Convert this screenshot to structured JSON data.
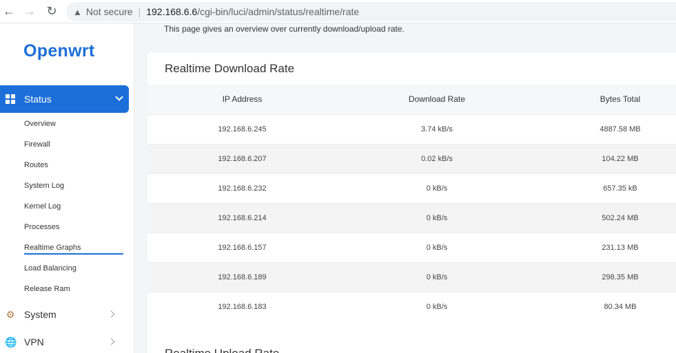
{
  "browser": {
    "not_secure": "Not secure",
    "url_host": "192.168.6.6",
    "url_path": "/cgi-bin/luci/admin/status/realtime/rate"
  },
  "sidebar": {
    "logo": "Openwrt",
    "active_menu": {
      "label": "Status",
      "icon": "grid-icon"
    },
    "submenu": [
      {
        "label": "Overview"
      },
      {
        "label": "Firewall"
      },
      {
        "label": "Routes"
      },
      {
        "label": "System Log"
      },
      {
        "label": "Kernel Log"
      },
      {
        "label": "Processes"
      },
      {
        "label": "Realtime Graphs",
        "current": true
      },
      {
        "label": "Load Balancing"
      },
      {
        "label": "Release Ram"
      }
    ],
    "menu": [
      {
        "label": "System",
        "icon": "gear-icon"
      },
      {
        "label": "VPN",
        "icon": "globe-icon"
      }
    ]
  },
  "main": {
    "intro": "This page gives an overview over currently download/upload rate.",
    "download_card": {
      "title": "Realtime Download Rate",
      "columns": [
        "IP Address",
        "Download Rate",
        "Bytes Total"
      ],
      "rows": [
        [
          "192.168.6.245",
          "3.74 kB/s",
          "4887.58 MB"
        ],
        [
          "192.168.6.207",
          "0.02 kB/s",
          "104.22 MB"
        ],
        [
          "192.168.6.232",
          "0 kB/s",
          "657.35 kB"
        ],
        [
          "192.168.6.214",
          "0 kB/s",
          "502.24 MB"
        ],
        [
          "192.168.6.157",
          "0 kB/s",
          "231.13 MB"
        ],
        [
          "192.168.6.189",
          "0 kB/s",
          "298.35 MB"
        ],
        [
          "192.168.6.183",
          "0 kB/s",
          "80.34 MB"
        ]
      ]
    },
    "upload_card": {
      "title": "Realtime Upload Rate"
    }
  },
  "colors": {
    "accent": "#1c6fd8"
  }
}
